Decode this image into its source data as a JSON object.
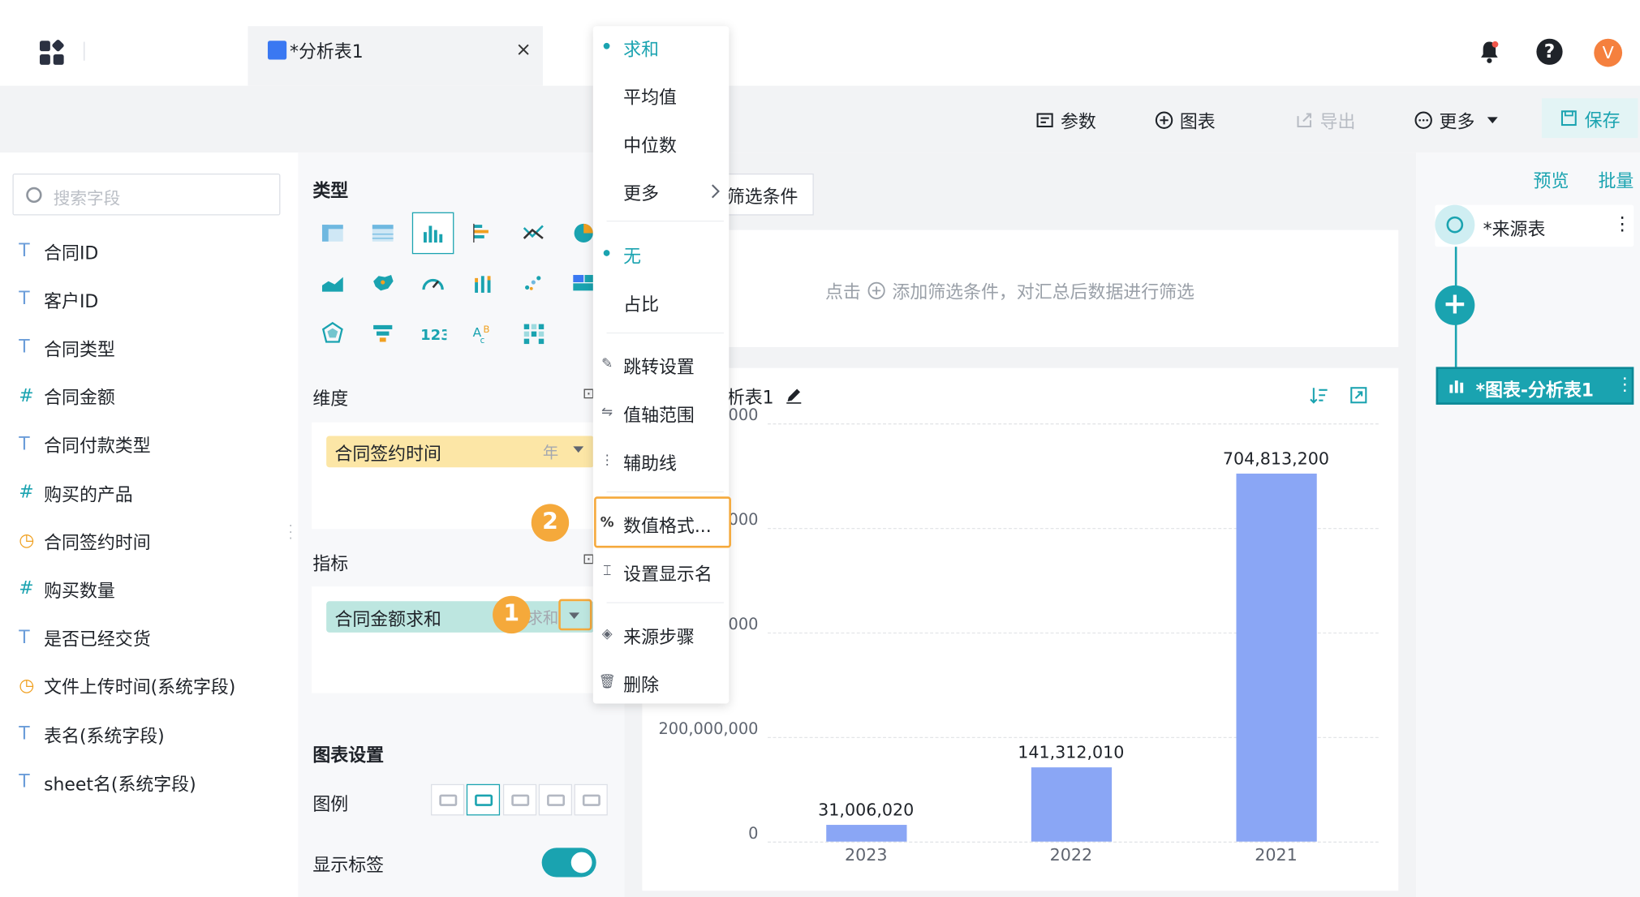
{
  "tab": {
    "title": "*分析表1",
    "close": "×"
  },
  "user": {
    "avatar_letter": "V",
    "help": "?"
  },
  "toolbar": {
    "params": "参数",
    "chart": "图表",
    "export": "导出",
    "more": "更多",
    "save": "保存"
  },
  "fields": {
    "search_placeholder": "搜索字段",
    "items": [
      {
        "type": "T",
        "label": "合同ID"
      },
      {
        "type": "T",
        "label": "客户ID"
      },
      {
        "type": "T",
        "label": "合同类型"
      },
      {
        "type": "#",
        "label": "合同金额"
      },
      {
        "type": "T",
        "label": "合同付款类型"
      },
      {
        "type": "#",
        "label": "购买的产品"
      },
      {
        "type": "time",
        "label": "合同签约时间"
      },
      {
        "type": "#",
        "label": "购买数量"
      },
      {
        "type": "T",
        "label": "是否已经交货"
      },
      {
        "type": "time",
        "label": "文件上传时间(系统字段)"
      },
      {
        "type": "T",
        "label": "表名(系统字段)"
      },
      {
        "type": "T",
        "label": "sheet名(系统字段)"
      }
    ]
  },
  "config": {
    "type_label": "类型",
    "dimension_label": "维度",
    "dimension_pill": "合同签约时间",
    "dimension_sub": "年",
    "metric_label": "指标",
    "metric_pill": "合同金额求和",
    "metric_sub": "求和",
    "chart_settings_label": "图表设置",
    "legend_label": "图例",
    "show_labels_label": "显示标签"
  },
  "badges": {
    "one": "1",
    "two": "2"
  },
  "filter": {
    "button": "筛选条件",
    "hint_prefix": "点击",
    "hint": "添加筛选条件，对汇总后数据进行筛选"
  },
  "chart": {
    "title": "分析表1",
    "title_prefix": "析表1"
  },
  "chart_data": {
    "type": "bar",
    "categories": [
      "2023",
      "2022",
      "2021"
    ],
    "values": [
      31006020,
      141312010,
      704813200
    ],
    "data_labels": [
      "31,006,020",
      "141,312,010",
      "704,813,200"
    ],
    "ytick_labels": [
      "0",
      "200,000,000",
      "000",
      "000",
      "000"
    ],
    "ylim": [
      0,
      800000000
    ],
    "color": "#8aa6f5",
    "grid": true
  },
  "flow": {
    "preview": "预览",
    "batch": "批量",
    "source": "*来源表",
    "chart_node": "*图表-分析表1"
  },
  "menu": {
    "agg": [
      "求和",
      "平均值",
      "中位数",
      "更多"
    ],
    "ratio": [
      "无",
      "占比"
    ],
    "actions": [
      "跳转设置",
      "值轴范围",
      "辅助线",
      "数值格式...",
      "设置显示名",
      "来源步骤",
      "删除"
    ]
  },
  "colors": {
    "accent": "#1aa3b0",
    "bar": "#8aa6f5",
    "highlight": "#f5a93b"
  }
}
